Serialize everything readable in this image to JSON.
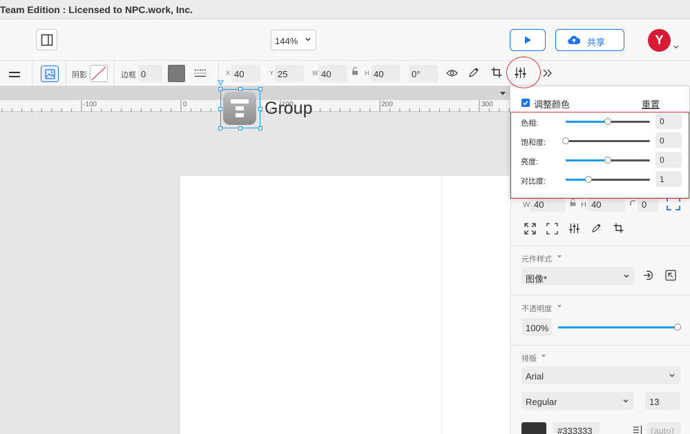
{
  "window": {
    "title": "Team Edition : Licensed to NPC.work, Inc."
  },
  "header": {
    "zoom": "144%",
    "share_label": "共享",
    "avatar_letter": "Y"
  },
  "toolbar": {
    "shadow_label": "阴影",
    "border_label": "边框",
    "border_value": "0",
    "x_label": "X",
    "x_value": "40",
    "y_label": "Y",
    "y_value": "25",
    "w_label": "W",
    "w_value": "40",
    "h_label": "H",
    "h_value": "40",
    "rotation_value": "0°"
  },
  "ruler": {
    "ticks": [
      "-100",
      "0",
      "100",
      "200",
      "300"
    ]
  },
  "canvas": {
    "group_label": "Group"
  },
  "adjust_popup": {
    "title": "调整颜色",
    "reset_label": "重置",
    "sliders": [
      {
        "label": "色相:",
        "value": "0",
        "level": 0.5
      },
      {
        "label": "饱和度:",
        "value": "0",
        "level": 0.0
      },
      {
        "label": "亮度:",
        "value": "0",
        "level": 0.5
      },
      {
        "label": "对比度:",
        "value": "1",
        "level": 0.27
      }
    ]
  },
  "right_panel": {
    "w_label": "W",
    "w_value": "40",
    "h_label": "H",
    "h_value": "40",
    "corner_value": "0",
    "style_section": "元件样式",
    "style_value": "图像*",
    "opacity_section": "不透明度",
    "opacity_value": "100%",
    "opacity_level": 1.0,
    "typography_section": "排版",
    "font_family": "Arial",
    "font_weight": "Regular",
    "font_size": "13",
    "color_hex": "#333333",
    "line_height_placeholder": "(auto)"
  }
}
